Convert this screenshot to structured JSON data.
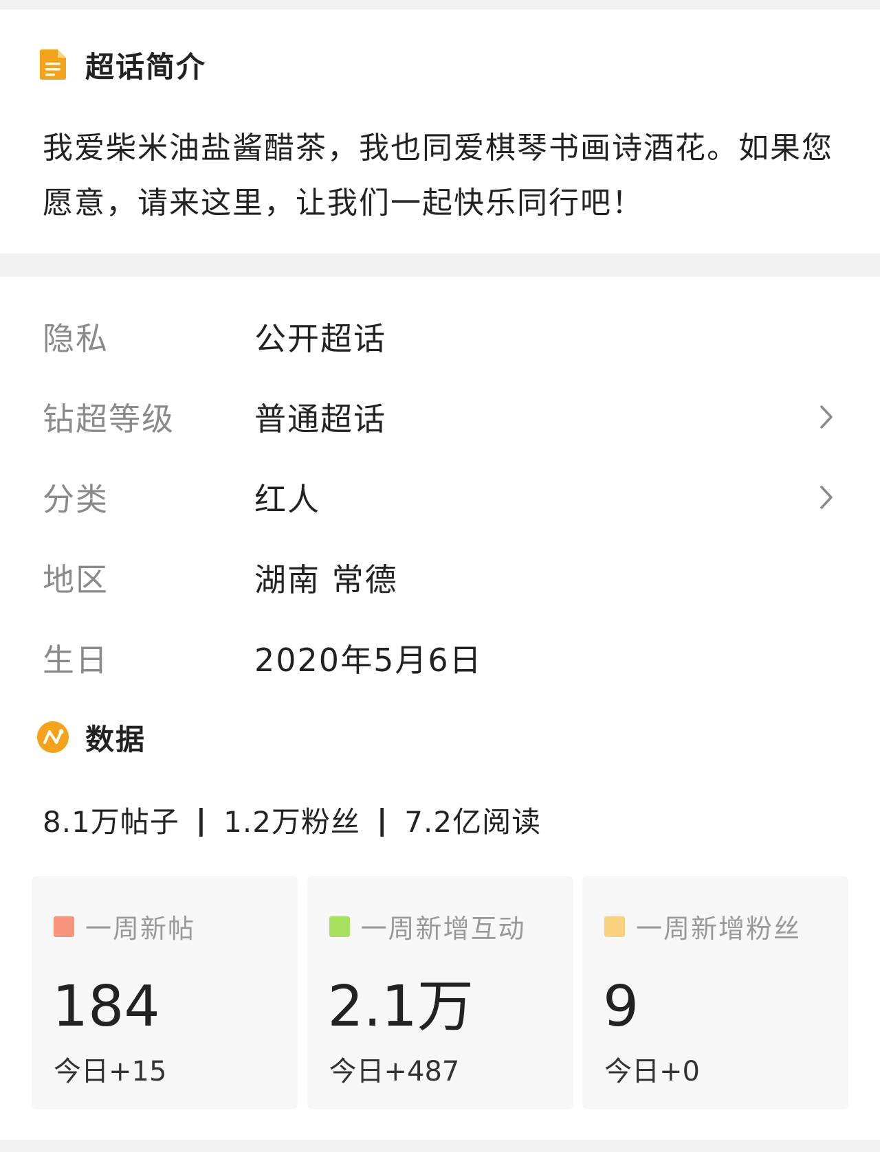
{
  "intro": {
    "title": "超话简介",
    "text": "我爱柴米油盐酱醋茶，我也同爱棋琴书画诗酒花。如果您愿意，请来这里，让我们一起快乐同行吧！",
    "icon": "document-icon",
    "icon_color": "#f5a21b"
  },
  "info": {
    "rows": [
      {
        "label": "隐私",
        "value": "公开超话",
        "has_chevron": false
      },
      {
        "label": "钻超等级",
        "value": "普通超话",
        "has_chevron": true
      },
      {
        "label": "分类",
        "value": "红人",
        "has_chevron": true
      },
      {
        "label": "地区",
        "value": "湖南 常德",
        "has_chevron": false
      },
      {
        "label": "生日",
        "value": "2020年5月6日",
        "has_chevron": false
      }
    ]
  },
  "data": {
    "title": "数据",
    "icon": "data-trend-icon",
    "icon_color": "#f5a21b",
    "summary": {
      "posts": "8.1万帖子",
      "fans": "1.2万粉丝",
      "reads": "7.2亿阅读",
      "separator": "|"
    },
    "stats": [
      {
        "label": "一周新帖",
        "value": "184",
        "today": "今日+15",
        "color": "#f8947c"
      },
      {
        "label": "一周新增互动",
        "value": "2.1万",
        "today": "今日+487",
        "color": "#a8e05f"
      },
      {
        "label": "一周新增粉丝",
        "value": "9",
        "today": "今日+0",
        "color": "#f8d27c"
      }
    ]
  }
}
